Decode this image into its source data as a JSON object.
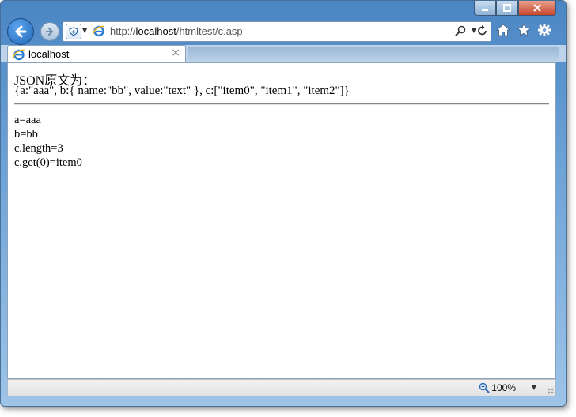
{
  "browser": {
    "address_url_prefix": "http://",
    "address_url_host": "localhost",
    "address_url_path": "/htmltest/c.asp",
    "tab_title": "localhost",
    "tab_close": "×",
    "zoom_level": "100%"
  },
  "page": {
    "label": "JSON原文为：",
    "json_raw": "{a:\"aaa\", b:{ name:\"bb\", value:\"text\" }, c:[\"item0\", \"item1\", \"item2\"]}",
    "results": [
      "a=aaa",
      "b=bb",
      "c.length=3",
      "c.get(0)=item0"
    ]
  },
  "icons": [
    "minimize-icon",
    "maximize-icon",
    "close-icon",
    "back-arrow-icon",
    "forward-arrow-icon",
    "shield-icon",
    "ie-logo-icon",
    "search-icon",
    "refresh-icon",
    "home-icon",
    "favorites-star-icon",
    "tools-gear-icon",
    "zoom-icon"
  ]
}
